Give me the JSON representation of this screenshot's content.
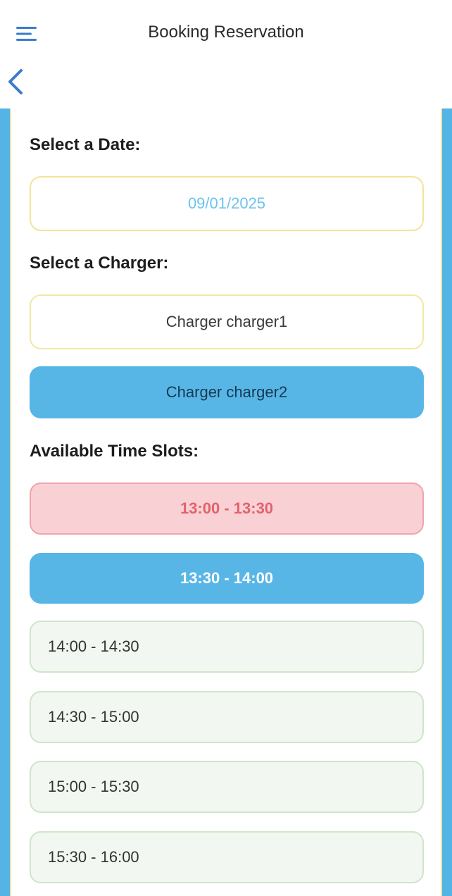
{
  "header": {
    "title": "Booking Reservation"
  },
  "sections": {
    "date_label": "Select a Date:",
    "charger_label": "Select a Charger:",
    "slots_label": "Available Time Slots:"
  },
  "date": {
    "value": "09/01/2025"
  },
  "chargers": [
    {
      "label": "Charger charger1",
      "selected": false
    },
    {
      "label": "Charger charger2",
      "selected": true
    }
  ],
  "time_slots": [
    {
      "label": "13:00 - 13:30",
      "state": "booked"
    },
    {
      "label": "13:30 - 14:00",
      "state": "selected"
    },
    {
      "label": "14:00 - 14:30",
      "state": "available"
    },
    {
      "label": "14:30 - 15:00",
      "state": "available"
    },
    {
      "label": "15:00 - 15:30",
      "state": "available"
    },
    {
      "label": "15:30 - 16:00",
      "state": "available"
    }
  ],
  "colors": {
    "accent_blue": "#58b6e6",
    "booked_red": "#e0636d",
    "booked_bg": "#f9d1d4",
    "available_bg": "#f3f7f1",
    "date_text": "#6cc3ee",
    "field_border_yellow": "#f2e49a"
  },
  "icons": {
    "menu": "hamburger-menu-icon",
    "back": "chevron-left-icon"
  }
}
